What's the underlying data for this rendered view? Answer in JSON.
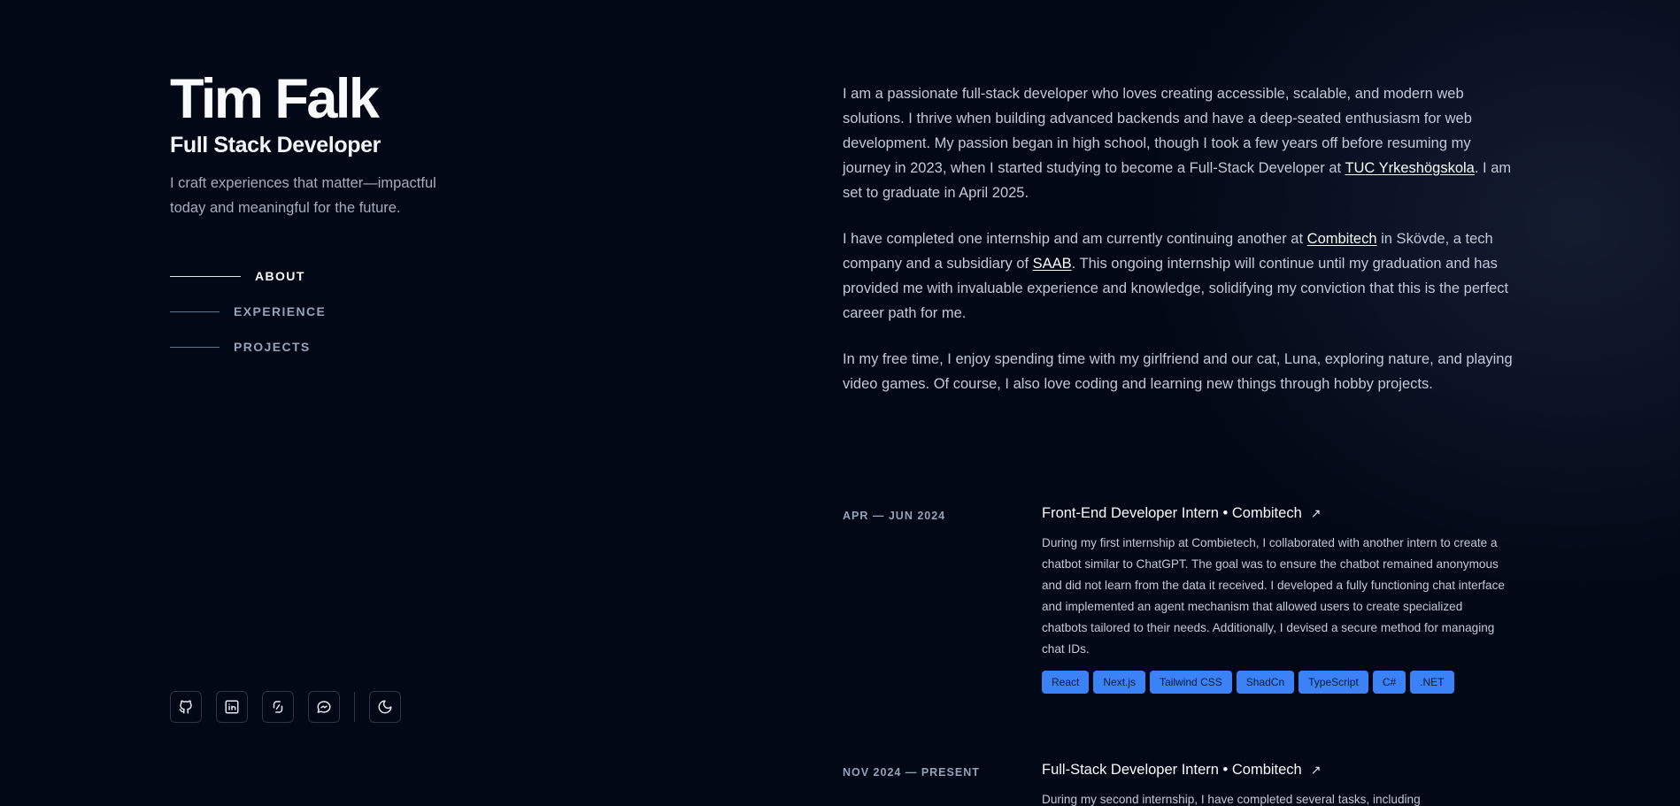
{
  "header": {
    "name": "Tim Falk",
    "role": "Full Stack Developer",
    "tagline": "I craft experiences that matter—impactful today and meaningful for the future."
  },
  "nav": {
    "items": [
      {
        "label": "ABOUT",
        "active": true
      },
      {
        "label": "EXPERIENCE",
        "active": false
      },
      {
        "label": "PROJECTS",
        "active": false
      }
    ]
  },
  "socials": [
    "github-icon",
    "linkedin-icon",
    "codepen-icon",
    "messenger-icon",
    "moon-icon"
  ],
  "about": {
    "p1_a": "I am a passionate full-stack developer who loves creating accessible, scalable, and modern web solutions. I thrive when building advanced backends and have a deep-seated enthusiasm for web development. My passion began in high school, though I took a few years off before resuming my journey in 2023, when I started studying to become a Full-Stack Developer at ",
    "p1_link": "TUC Yrkeshögskola",
    "p1_b": ". I am set to graduate in April 2025.",
    "p2_a": "I have completed one internship and am currently continuing another at ",
    "p2_link1": "Combitech",
    "p2_b": " in Skövde, a tech company and a subsidiary of ",
    "p2_link2": "SAAB",
    "p2_c": ". This ongoing internship will continue until my graduation and has provided me with invaluable experience and knowledge, solidifying my conviction that this is the perfect career path for me.",
    "p3": "In my free time, I enjoy spending time with my girlfriend and our cat, Luna, exploring nature, and playing video games. Of course, I also love coding and learning new things through hobby projects."
  },
  "experience": [
    {
      "date": "APR — JUN 2024",
      "title": "Front-End Developer Intern • Combitech",
      "arrow": "↗",
      "description": "During my first internship at Combietech, I collaborated with another intern to create a chatbot similar to ChatGPT. The goal was to ensure the chatbot remained anonymous and did not learn from the data it received. I developed a fully functioning chat interface and implemented an agent mechanism that allowed users to create specialized chatbots tailored to their needs. Additionally, I devised a secure method for managing chat IDs.",
      "tags": [
        "React",
        "Next.js",
        "Tailwind CSS",
        "ShadCn",
        "TypeScript",
        "C#",
        ".NET"
      ]
    },
    {
      "date": "NOV 2024 — PRESENT",
      "title": "Full-Stack Developer Intern • Combitech",
      "arrow": "↗",
      "description": "During my second internship, I have completed several tasks, including"
    }
  ],
  "colors": {
    "background": "#030816",
    "accent": "#3b82f6",
    "text": "#c1c9d6",
    "heading": "#f8fafc"
  }
}
